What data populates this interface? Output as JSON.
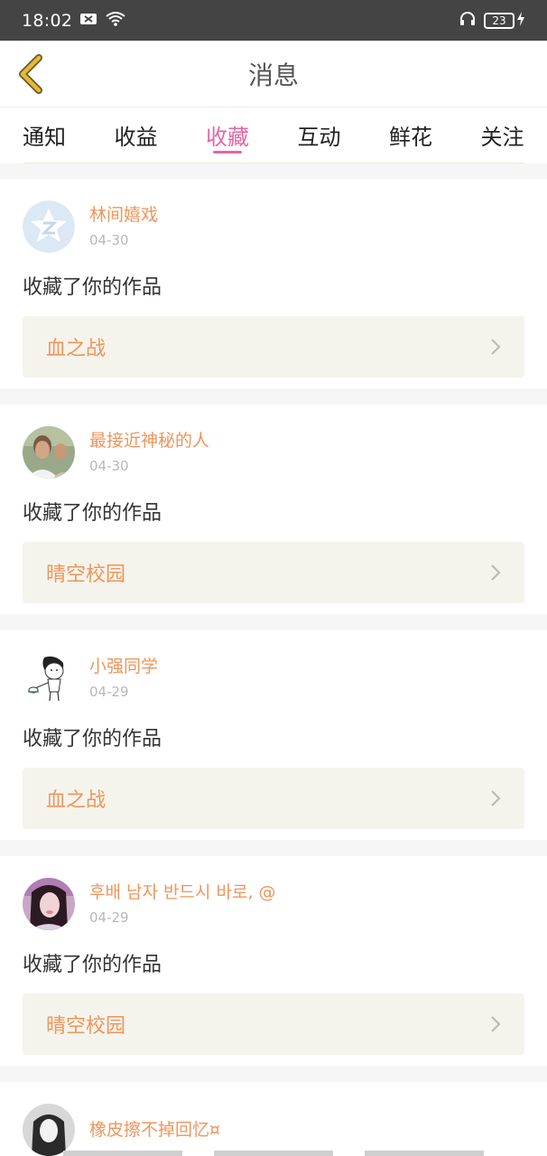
{
  "status_bar": {
    "time": "18:02",
    "battery": "23"
  },
  "header": {
    "title": "消息"
  },
  "tabs": [
    {
      "label": "通知",
      "active": false
    },
    {
      "label": "收益",
      "active": false
    },
    {
      "label": "收藏",
      "active": true
    },
    {
      "label": "互动",
      "active": false
    },
    {
      "label": "鲜花",
      "active": false
    },
    {
      "label": "关注",
      "active": false
    }
  ],
  "feed": {
    "items": [
      {
        "username": "林间嬉戏",
        "date": "04-30",
        "action": "收藏了你的作品",
        "work": "血之战"
      },
      {
        "username": "最接近神秘的人",
        "date": "04-30",
        "action": "收藏了你的作品",
        "work": "晴空校园"
      },
      {
        "username": "小强同学",
        "date": "04-29",
        "action": "收藏了你的作品",
        "work": "血之战"
      },
      {
        "username": "후배 남자 반드시 바로, @",
        "date": "04-29",
        "action": "收藏了你的作品",
        "work": "晴空校园"
      },
      {
        "username": "橡皮擦不掉回忆¤"
      }
    ]
  },
  "colors": {
    "accent": "#e765a5",
    "username": "#f0955b",
    "status_bar": "#444444",
    "back_arrow": "#e3b83c"
  }
}
